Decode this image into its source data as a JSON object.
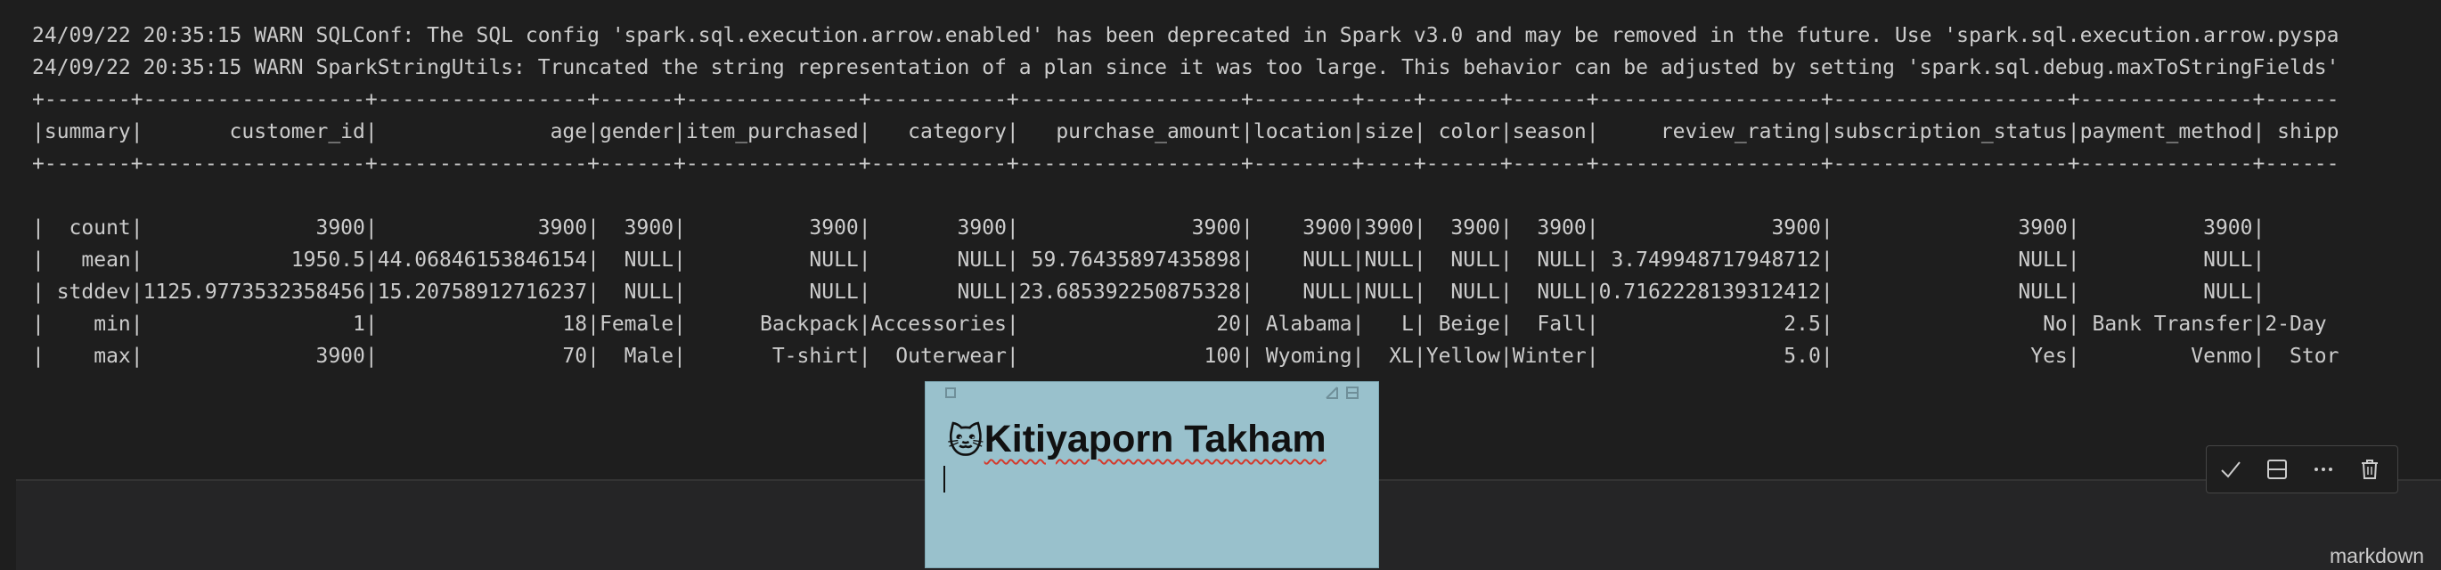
{
  "output": {
    "warn_lines": [
      "24/09/22 20:35:15 WARN SQLConf: The SQL config 'spark.sql.execution.arrow.enabled' has been deprecated in Spark v3.0 and may be removed in the future. Use 'spark.sql.execution.arrow.pyspa",
      "24/09/22 20:35:15 WARN SparkStringUtils: Truncated the string representation of a plan since it was too large. This behavior can be adjusted by setting 'spark.sql.debug.maxToStringFields'"
    ],
    "table": {
      "border_top": "+-------+------------------+-----------------+------+--------------+-----------+------------------+--------+----+------+------+------------------+-------------------+--------------+------",
      "header": "|summary|       customer_id|              age|gender|item_purchased|   category|   purchase_amount|location|size| color|season|     review_rating|subscription_status|payment_method| shipp",
      "border_mid": "+-------+------------------+-----------------+------+--------------+-----------+------------------+--------+----+------+------+------------------+-------------------+--------------+------",
      "rows": [
        "|  count|              3900|             3900|  3900|          3900|       3900|              3900|    3900|3900|  3900|  3900|              3900|               3900|          3900|      ",
        "|   mean|            1950.5|44.06846153846154|  NULL|          NULL|       NULL| 59.76435897435898|    NULL|NULL|  NULL|  NULL| 3.749948717948712|               NULL|          NULL|      ",
        "| stddev|1125.9773532358456|15.20758912716237|  NULL|          NULL|       NULL|23.685392250875328|    NULL|NULL|  NULL|  NULL|0.7162228139312412|               NULL|          NULL|      ",
        "|    min|                 1|               18|Female|      Backpack|Accessories|                20| Alabama|   L| Beige|  Fall|               2.5|                 No| Bank Transfer|2-Day ",
        "|    max|              3900|               70|  Male|       T-shirt|  Outerwear|               100| Wyoming|  XL|Yellow|Winter|               5.0|                Yes|         Venmo|  Stor"
      ],
      "border_bottom": "+-------+------------------+-----------------+------+--------------+-----------+------------------+--------+----+------+------+------------------+-------------------+--------------+------"
    }
  },
  "sticky_note": {
    "emoji": "🐱",
    "title": "Kitiyaporn Takham"
  },
  "cell_toolbar": {
    "icons": [
      "check-icon",
      "split-cell-icon",
      "more-icon",
      "trash-icon"
    ]
  },
  "status": {
    "language": "markdown"
  },
  "colors": {
    "background": "#1e1e1e",
    "text": "#cccccc",
    "note_background": "#99c1cc",
    "spellcheck_underline": "#d33a2c"
  }
}
